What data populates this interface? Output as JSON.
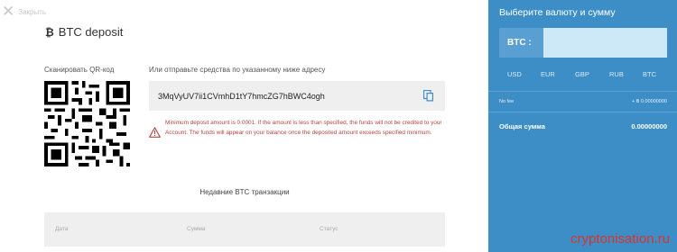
{
  "header": {
    "close_label": "Закрыть",
    "title": "BTC deposit",
    "btc_symbol": "₿"
  },
  "qr": {
    "label": "Сканировать QR-код"
  },
  "address": {
    "label": "Или отправьте средства по указанному ниже адресу",
    "value": "3MqVyUV7ii1CVmhD1tY7hmcZG7hBWC4ogh"
  },
  "warning": {
    "text": "Minimum deposit amount is 0.0001. If the amount is less than specified, the funds will not be credited to your Account. The funds will appear on your balance once the deposited amount exceeds specified minimum."
  },
  "transactions": {
    "title": "Недавние BTC транзакции",
    "columns": [
      "Дата",
      "Сумма",
      "Статус"
    ]
  },
  "panel": {
    "title": "Выберите валюту и сумму",
    "amount_label": "BTC :",
    "amount_value": "",
    "currencies": [
      "USD",
      "EUR",
      "GBP",
      "RUB",
      "BTC"
    ],
    "fee_label": "No fee",
    "fee_value": "+ Ƀ 0.00000000",
    "total_label": "Общая сумма",
    "total_value": "0.00000000"
  },
  "colors": {
    "panel_bg": "#3d8ec7",
    "input_bg": "#cde8f7",
    "warning": "#b8433f",
    "watermark": "#d9342b"
  },
  "watermark": "cryptonisation.ru"
}
